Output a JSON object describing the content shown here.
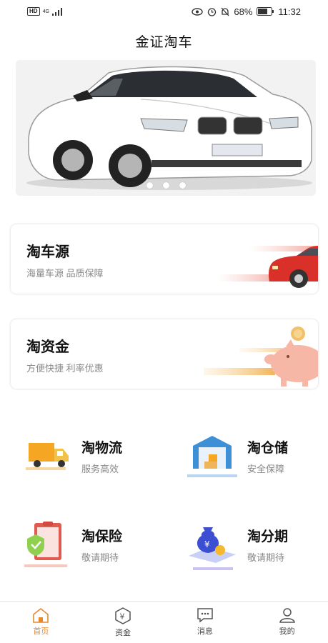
{
  "status_bar": {
    "hd": "HD",
    "network": "4G",
    "battery": "68%",
    "time": "11:32"
  },
  "app": {
    "title": "金证淘车"
  },
  "banner": {
    "slide_count": 3,
    "active_slide": 1
  },
  "cards": [
    {
      "title": "淘车源",
      "subtitle": "海量车源 品质保障"
    },
    {
      "title": "淘资金",
      "subtitle": "方便快捷 利率优惠"
    }
  ],
  "services": [
    {
      "title": "淘物流",
      "subtitle": "服务高效",
      "icon": "truck-icon"
    },
    {
      "title": "淘仓储",
      "subtitle": "安全保障",
      "icon": "warehouse-icon"
    },
    {
      "title": "淘保险",
      "subtitle": "敬请期待",
      "icon": "insurance-icon"
    },
    {
      "title": "淘分期",
      "subtitle": "敬请期待",
      "icon": "money-bag-icon"
    }
  ],
  "tabs": [
    {
      "label": "首页",
      "icon": "home-icon",
      "active": true
    },
    {
      "label": "资金",
      "icon": "yuan-icon",
      "active": false
    },
    {
      "label": "消息",
      "icon": "message-icon",
      "active": false
    },
    {
      "label": "我的",
      "icon": "user-icon",
      "active": false
    }
  ],
  "colors": {
    "accent": "#e8892c",
    "card_red": "#d9302a",
    "piggy": "#f6b7a6"
  }
}
